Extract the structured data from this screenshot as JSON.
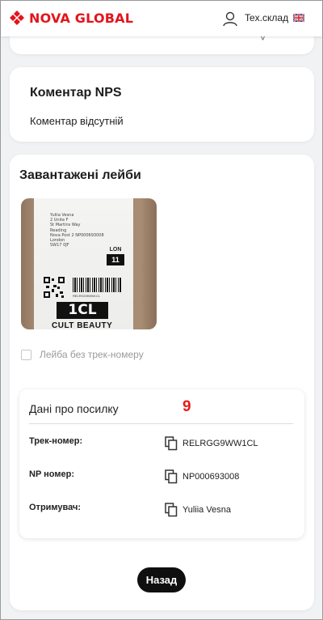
{
  "header": {
    "logo_text": "NOVA GLOBAL",
    "user_label": "Tex.склад",
    "brand_color": "#e3141c"
  },
  "nps": {
    "title": "Коментар NPS",
    "text": "Коментар відсутній"
  },
  "labels": {
    "title": "Завантажені лейби",
    "thumbnail": {
      "address_lines": [
        "Yuliia Vesna",
        "2 Unite F",
        "St Martins Way",
        "Reading",
        "Nova Post 2 NP000693008",
        "London",
        "SW17 0JF"
      ],
      "zone": "LON",
      "zone_num": "11",
      "code": "1CL",
      "barcode_number": "RELRGG9WW1CL",
      "bottom_text": "CULT BEAUTY"
    },
    "no_track_checkbox_label": "Лейба без трек-номеру"
  },
  "parcel": {
    "title": "Дані про посилку",
    "count": "9",
    "rows": [
      {
        "label": "Трек-номер:",
        "value": "RELRGG9WW1CL"
      },
      {
        "label": "NP номер:",
        "value": "NP000693008"
      },
      {
        "label": "Отримувач:",
        "value": "Yuliia Vesna"
      }
    ]
  },
  "actions": {
    "back_label": "Назад"
  },
  "icons": [
    "logo-icon",
    "user-icon",
    "uk-flag-icon",
    "copy-icon"
  ]
}
